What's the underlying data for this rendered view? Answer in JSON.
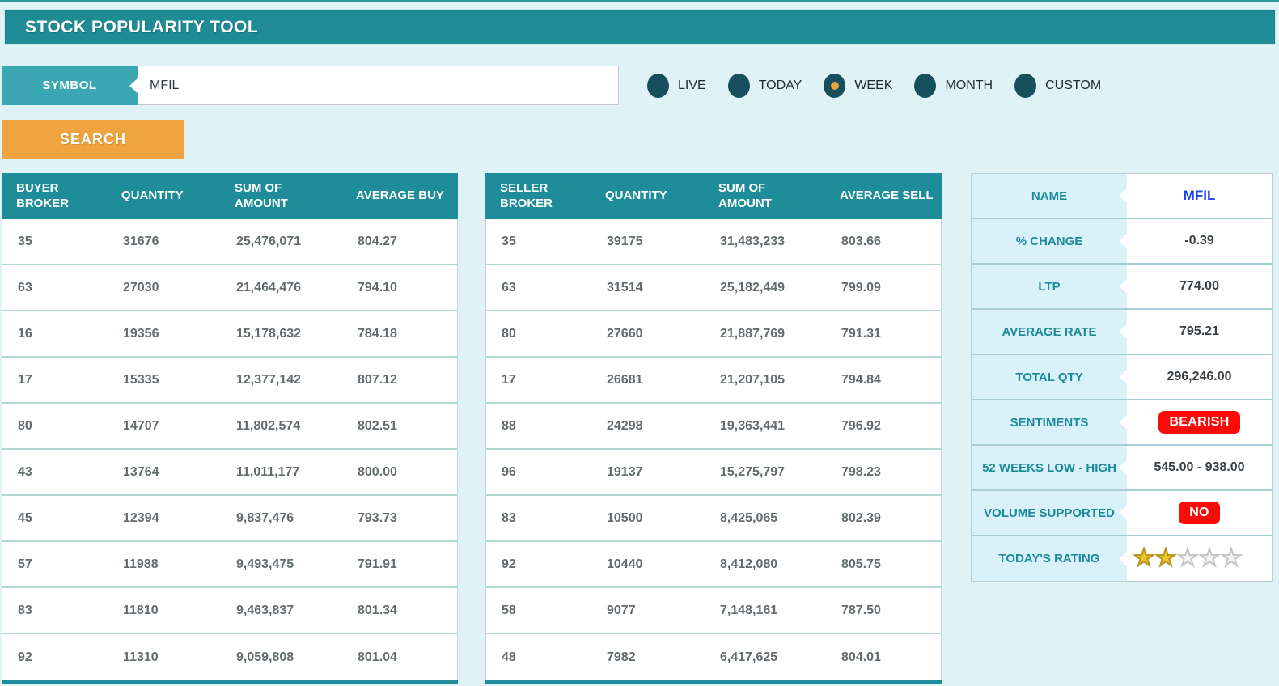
{
  "header": {
    "title": "STOCK POPULARITY TOOL"
  },
  "search_bar": {
    "symbol_label": "SYMBOL",
    "symbol_value": "MFIL",
    "search_button": "SEARCH",
    "filters": [
      {
        "label": "LIVE",
        "selected": false
      },
      {
        "label": "TODAY",
        "selected": false
      },
      {
        "label": "WEEK",
        "selected": true
      },
      {
        "label": "MONTH",
        "selected": false
      },
      {
        "label": "CUSTOM",
        "selected": false
      }
    ]
  },
  "buyer_table": {
    "headers": [
      "BUYER BROKER",
      "QUANTITY",
      "SUM OF AMOUNT",
      "AVERAGE BUY"
    ],
    "rows": [
      [
        "35",
        "31676",
        "25,476,071",
        "804.27"
      ],
      [
        "63",
        "27030",
        "21,464,476",
        "794.10"
      ],
      [
        "16",
        "19356",
        "15,178,632",
        "784.18"
      ],
      [
        "17",
        "15335",
        "12,377,142",
        "807.12"
      ],
      [
        "80",
        "14707",
        "11,802,574",
        "802.51"
      ],
      [
        "43",
        "13764",
        "11,011,177",
        "800.00"
      ],
      [
        "45",
        "12394",
        "9,837,476",
        "793.73"
      ],
      [
        "57",
        "11988",
        "9,493,475",
        "791.91"
      ],
      [
        "83",
        "11810",
        "9,463,837",
        "801.34"
      ],
      [
        "92",
        "11310",
        "9,059,808",
        "801.04"
      ]
    ]
  },
  "seller_table": {
    "headers": [
      "SELLER BROKER",
      "QUANTITY",
      "SUM OF AMOUNT",
      "AVERAGE SELL"
    ],
    "rows": [
      [
        "35",
        "39175",
        "31,483,233",
        "803.66"
      ],
      [
        "63",
        "31514",
        "25,182,449",
        "799.09"
      ],
      [
        "80",
        "27660",
        "21,887,769",
        "791.31"
      ],
      [
        "17",
        "26681",
        "21,207,105",
        "794.84"
      ],
      [
        "88",
        "24298",
        "19,363,441",
        "796.92"
      ],
      [
        "96",
        "19137",
        "15,275,797",
        "798.23"
      ],
      [
        "83",
        "10500",
        "8,425,065",
        "802.39"
      ],
      [
        "92",
        "10440",
        "8,412,080",
        "805.75"
      ],
      [
        "58",
        "9077",
        "7,148,161",
        "787.50"
      ],
      [
        "48",
        "7982",
        "6,417,625",
        "804.01"
      ]
    ]
  },
  "summary_panel": {
    "rows": [
      {
        "label": "NAME",
        "value": "MFIL",
        "style": "link"
      },
      {
        "label": "% CHANGE",
        "value": "-0.39",
        "style": "text"
      },
      {
        "label": "LTP",
        "value": "774.00",
        "style": "text"
      },
      {
        "label": "AVERAGE RATE",
        "value": "795.21",
        "style": "text"
      },
      {
        "label": "TOTAL QTY",
        "value": "296,246.00",
        "style": "text"
      },
      {
        "label": "SENTIMENTS",
        "value": "BEARISH",
        "style": "badge"
      },
      {
        "label": "52 WEEKS LOW - HIGH",
        "value": "545.00 - 938.00",
        "style": "text"
      },
      {
        "label": "VOLUME SUPPORTED",
        "value": "NO",
        "style": "badge"
      },
      {
        "label": "TODAY'S RATING",
        "style": "stars",
        "stars_active": 2,
        "stars_total": 5
      }
    ]
  },
  "colors": {
    "teal": "#1e8d99",
    "label_teal": "#3aa7b2",
    "orange": "#efa440",
    "red": "#fb0a0a",
    "link_blue": "#2144ee",
    "page_bg": "#dff2f6",
    "panel_label_bg": "#d9f2fa",
    "star_gold": "#edc725",
    "radio_dark": "#17505c",
    "radio_selected_dot": "#eda13c"
  }
}
